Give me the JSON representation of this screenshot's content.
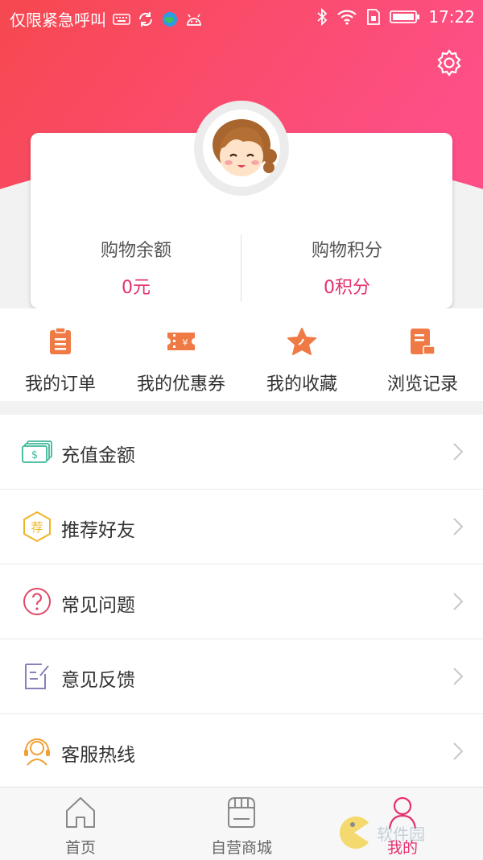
{
  "status_bar": {
    "carrier": "仅限紧急呼叫",
    "time": "17:22"
  },
  "colors": {
    "header_gradient_start": "#f6484f",
    "header_gradient_end": "#fe4f86",
    "accent": "#e5306f",
    "icon_orange": "#f07a45"
  },
  "account": {
    "balance_label": "购物余额",
    "balance_value": "0元",
    "points_label": "购物积分",
    "points_value": "0积分"
  },
  "quick_actions": [
    {
      "label": "我的订单",
      "icon": "clipboard-icon"
    },
    {
      "label": "我的优惠券",
      "icon": "coupon-icon"
    },
    {
      "label": "我的收藏",
      "icon": "star-icon"
    },
    {
      "label": "浏览记录",
      "icon": "history-icon"
    }
  ],
  "menu": [
    {
      "label": "充值金额",
      "icon": "money-icon"
    },
    {
      "label": "推荐好友",
      "icon": "recommend-icon",
      "icon_text": "荐"
    },
    {
      "label": "常见问题",
      "icon": "question-icon"
    },
    {
      "label": "意见反馈",
      "icon": "feedback-icon"
    },
    {
      "label": "客服热线",
      "icon": "headset-icon"
    }
  ],
  "tabs": [
    {
      "label": "首页",
      "icon": "home-icon"
    },
    {
      "label": "自营商城",
      "icon": "store-icon"
    },
    {
      "label": "我的",
      "icon": "profile-icon",
      "active": true
    }
  ],
  "watermark": "软件园"
}
